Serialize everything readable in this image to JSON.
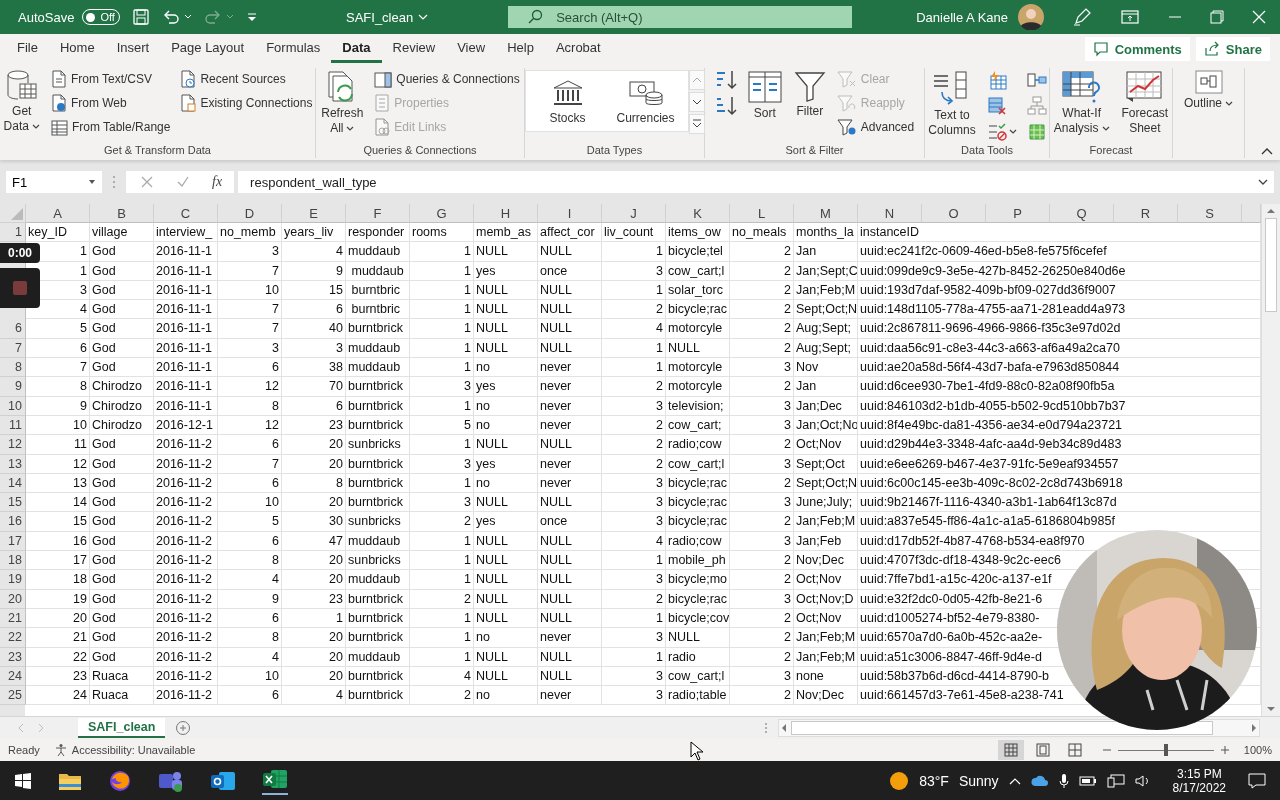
{
  "title_bar": {
    "autosave_label": "AutoSave",
    "autosave_on": false,
    "toggle_text": "Off",
    "file_name": "SAFI_clean",
    "search_placeholder": "Search (Alt+Q)",
    "user_name": "Danielle A Kane"
  },
  "menu_tabs": [
    {
      "label": "File",
      "selected": false
    },
    {
      "label": "Home",
      "selected": false
    },
    {
      "label": "Insert",
      "selected": false
    },
    {
      "label": "Page Layout",
      "selected": false
    },
    {
      "label": "Formulas",
      "selected": false
    },
    {
      "label": "Data",
      "selected": true
    },
    {
      "label": "Review",
      "selected": false
    },
    {
      "label": "View",
      "selected": false
    },
    {
      "label": "Help",
      "selected": false
    },
    {
      "label": "Acrobat",
      "selected": false
    }
  ],
  "comments_button": "Comments",
  "share_button": "Share",
  "ribbon": {
    "groups": [
      {
        "label": "Get & Transform Data",
        "columns": [
          [
            {
              "kind": "large",
              "lines": [
                "Get",
                "Data"
              ],
              "dropdown": true,
              "disabled": false
            }
          ],
          [
            {
              "kind": "small",
              "lines": [
                "From Text/CSV"
              ],
              "dropdown": false,
              "disabled": false
            },
            {
              "kind": "small",
              "lines": [
                "From Web"
              ],
              "dropdown": false,
              "disabled": false
            },
            {
              "kind": "small",
              "lines": [
                "From Table/Range"
              ],
              "dropdown": false,
              "disabled": false
            }
          ],
          [
            {
              "kind": "small",
              "lines": [
                "Recent Sources"
              ],
              "dropdown": false,
              "disabled": false
            },
            {
              "kind": "small",
              "lines": [
                "Existing Connections"
              ],
              "dropdown": false,
              "disabled": false
            }
          ]
        ]
      },
      {
        "label": "Queries & Connections",
        "columns": [
          [
            {
              "kind": "large",
              "lines": [
                "Refresh",
                "All"
              ],
              "dropdown": true,
              "disabled": false
            }
          ],
          [
            {
              "kind": "small",
              "lines": [
                "Queries & Connections"
              ],
              "dropdown": false,
              "disabled": false
            },
            {
              "kind": "small",
              "lines": [
                "Properties"
              ],
              "dropdown": false,
              "disabled": true
            },
            {
              "kind": "small",
              "lines": [
                "Edit Links"
              ],
              "dropdown": false,
              "disabled": true
            }
          ]
        ]
      },
      {
        "label": "Data Types",
        "columns": [
          [
            {
              "kind": "gallery",
              "lines": [
                "Stocks"
              ],
              "dropdown": false,
              "disabled": false
            }
          ],
          [
            {
              "kind": "gallery",
              "lines": [
                "Currencies"
              ],
              "dropdown": false,
              "disabled": false
            }
          ]
        ]
      },
      {
        "label": "Sort & Filter",
        "columns": [
          [
            {
              "kind": "icon",
              "dropdown": false,
              "disabled": false
            },
            {
              "kind": "icon",
              "dropdown": false,
              "disabled": false
            }
          ],
          [
            {
              "kind": "large",
              "lines": [
                "Sort"
              ],
              "dropdown": false,
              "disabled": false
            }
          ],
          [
            {
              "kind": "large",
              "lines": [
                "Filter"
              ],
              "dropdown": false,
              "disabled": false
            }
          ],
          [
            {
              "kind": "small",
              "lines": [
                "Clear"
              ],
              "dropdown": false,
              "disabled": true
            },
            {
              "kind": "small",
              "lines": [
                "Reapply"
              ],
              "dropdown": false,
              "disabled": true
            },
            {
              "kind": "small",
              "lines": [
                "Advanced"
              ],
              "dropdown": false,
              "disabled": false
            }
          ]
        ]
      },
      {
        "label": "Data Tools",
        "columns": [
          [
            {
              "kind": "large",
              "lines": [
                "Text to",
                "Columns"
              ],
              "dropdown": false,
              "disabled": false
            }
          ],
          [
            {
              "kind": "icon",
              "dropdown": false,
              "disabled": false
            },
            {
              "kind": "icon",
              "dropdown": false,
              "disabled": false
            },
            {
              "kind": "icon",
              "dropdown": true,
              "disabled": false
            }
          ],
          [
            {
              "kind": "icon",
              "dropdown": false,
              "disabled": false
            },
            {
              "kind": "icon",
              "dropdown": false,
              "disabled": false
            },
            {
              "kind": "icon",
              "dropdown": false,
              "disabled": false
            }
          ]
        ]
      },
      {
        "label": "Forecast",
        "columns": [
          [
            {
              "kind": "large",
              "lines": [
                "What-If",
                "Analysis"
              ],
              "dropdown": true,
              "disabled": false
            }
          ],
          [
            {
              "kind": "large",
              "lines": [
                "Forecast",
                "Sheet"
              ],
              "dropdown": false,
              "disabled": false
            }
          ]
        ]
      },
      {
        "columns": [
          [
            {
              "kind": "large",
              "lines": [
                "Outline"
              ],
              "dropdown": true,
              "disabled": false
            }
          ]
        ]
      }
    ]
  },
  "formula_bar": {
    "name_box": "F1",
    "fx": "fx",
    "value": "respondent_wall_type"
  },
  "columns": [
    "A",
    "B",
    "C",
    "D",
    "E",
    "F",
    "G",
    "H",
    "I",
    "J",
    "K",
    "L",
    "M",
    "N",
    "O",
    "P",
    "Q",
    "R",
    "S"
  ],
  "rows": [
    {
      "number": "1",
      "cells": [
        "key_ID",
        "village",
        "interview_",
        "no_memb",
        "years_liv",
        "responder",
        "rooms",
        "memb_as",
        "affect_cor",
        "liv_count",
        "items_ow",
        "no_meals",
        "months_la",
        "instanceID"
      ]
    },
    {
      "cells": [
        "1",
        "God",
        "2016-11-1",
        "3",
        "4",
        "muddaub",
        "1",
        "NULL",
        "NULL",
        "1",
        "bicycle;tel",
        "2",
        "Jan",
        "uuid:ec241f2c-0609-46ed-b5e8-fe575f6cefef"
      ]
    },
    {
      "cells": [
        "1",
        "God",
        "2016-11-1",
        "7",
        "9",
        " muddaub",
        "1",
        "yes",
        "once",
        "3",
        "cow_cart;l",
        "2",
        "Jan;Sept;C",
        "uuid:099de9c9-3e5e-427b-8452-26250e840d6e"
      ]
    },
    {
      "cells": [
        "3",
        "God",
        "2016-11-1",
        "10",
        "15",
        " burntbric",
        "1",
        "NULL",
        "NULL",
        "1",
        "solar_torc",
        "2",
        "Jan;Feb;M",
        "uuid:193d7daf-9582-409b-bf09-027dd36f9007"
      ]
    },
    {
      "cells": [
        "4",
        "God",
        "2016-11-1",
        "7",
        "6",
        " burntbric",
        "1",
        "NULL",
        "NULL",
        "2",
        "bicycle;rac",
        "2",
        "Sept;Oct;N",
        "uuid:148d1105-778a-4755-aa71-281eadd4a973"
      ]
    },
    {
      "number": "6",
      "cells": [
        "5",
        "God",
        "2016-11-1",
        "7",
        "40",
        "burntbrick",
        "1",
        "NULL",
        "NULL",
        "4",
        "motorcyle",
        "2",
        "Aug;Sept;",
        "uuid:2c867811-9696-4966-9866-f35c3e97d02d"
      ]
    },
    {
      "number": "7",
      "cells": [
        "6",
        "God",
        "2016-11-1",
        "3",
        "3",
        "muddaub",
        "1",
        "NULL",
        "NULL",
        "1",
        "NULL",
        "2",
        "Aug;Sept;",
        "uuid:daa56c91-c8e3-44c3-a663-af6a49a2ca70"
      ]
    },
    {
      "number": "8",
      "cells": [
        "7",
        "God",
        "2016-11-1",
        "6",
        "38",
        "muddaub",
        "1",
        "no",
        "never",
        "1",
        "motorcyle",
        "3",
        "Nov",
        "uuid:ae20a58d-56f4-43d7-bafa-e7963d850844"
      ]
    },
    {
      "number": "9",
      "cells": [
        "8",
        "Chirodzo",
        "2016-11-1",
        "12",
        "70",
        "burntbrick",
        "3",
        "yes",
        "never",
        "2",
        "motorcyle",
        "2",
        "Jan",
        "uuid:d6cee930-7be1-4fd9-88c0-82a08f90fb5a"
      ]
    },
    {
      "number": "10",
      "cells": [
        "9",
        "Chirodzo",
        "2016-11-1",
        "8",
        "6",
        "burntbrick",
        "1",
        "no",
        "never",
        "3",
        "television;",
        "3",
        "Jan;Dec",
        "uuid:846103d2-b1db-4055-b502-9cd510bb7b37"
      ]
    },
    {
      "number": "11",
      "cells": [
        "10",
        "Chirodzo",
        "2016-12-1",
        "12",
        "23",
        "burntbrick",
        "5",
        "no",
        "never",
        "2",
        "cow_cart;",
        "3",
        "Jan;Oct;No",
        "uuid:8f4e49bc-da81-4356-ae34-e0d794a23721"
      ]
    },
    {
      "number": "12",
      "cells": [
        "11",
        "God",
        "2016-11-2",
        "6",
        "20",
        "sunbricks",
        "1",
        "NULL",
        "NULL",
        "2",
        "radio;cow",
        "2",
        "Oct;Nov",
        "uuid:d29b44e3-3348-4afc-aa4d-9eb34c89d483"
      ]
    },
    {
      "number": "13",
      "cells": [
        "12",
        "God",
        "2016-11-2",
        "7",
        "20",
        "burntbrick",
        "3",
        "yes",
        "never",
        "2",
        "cow_cart;l",
        "3",
        "Sept;Oct",
        "uuid:e6ee6269-b467-4e37-91fc-5e9eaf934557"
      ]
    },
    {
      "number": "14",
      "cells": [
        "13",
        "God",
        "2016-11-2",
        "6",
        "8",
        "burntbrick",
        "1",
        "no",
        "never",
        "3",
        "bicycle;rac",
        "2",
        "Sept;Oct;N",
        "uuid:6c00c145-ee3b-409c-8c02-2c8d743b6918"
      ]
    },
    {
      "number": "15",
      "cells": [
        "14",
        "God",
        "2016-11-2",
        "10",
        "20",
        "burntbrick",
        "3",
        "NULL",
        "NULL",
        "3",
        "bicycle;rac",
        "3",
        "June;July;",
        "uuid:9b21467f-1116-4340-a3b1-1ab64f13c87d"
      ]
    },
    {
      "number": "16",
      "cells": [
        "15",
        "God",
        "2016-11-2",
        "5",
        "30",
        "sunbricks",
        "2",
        "yes",
        "once",
        "3",
        "bicycle;rac",
        "2",
        "Jan;Feb;M",
        "uuid:a837e545-ff86-4a1c-a1a5-6186804b985f"
      ]
    },
    {
      "number": "17",
      "cells": [
        "16",
        "God",
        "2016-11-2",
        "6",
        "47",
        "muddaub",
        "1",
        "NULL",
        "NULL",
        "4",
        "radio;cow",
        "3",
        "Jan;Feb",
        "uuid:d17db52f-4b87-4768-b534-ea8f970"
      ]
    },
    {
      "number": "18",
      "cells": [
        "17",
        "God",
        "2016-11-2",
        "8",
        "20",
        "sunbricks",
        "1",
        "NULL",
        "NULL",
        "1",
        "mobile_ph",
        "2",
        "Nov;Dec",
        "uuid:4707f3dc-df18-4348-9c2c-eec6"
      ]
    },
    {
      "number": "19",
      "cells": [
        "18",
        "God",
        "2016-11-2",
        "4",
        "20",
        "muddaub",
        "1",
        "NULL",
        "NULL",
        "3",
        "bicycle;mo",
        "2",
        "Oct;Nov",
        "uuid:7ffe7bd1-a15c-420c-a137-e1f"
      ]
    },
    {
      "number": "20",
      "cells": [
        "19",
        "God",
        "2016-11-2",
        "9",
        "23",
        "burntbrick",
        "2",
        "NULL",
        "NULL",
        "2",
        "bicycle;rac",
        "3",
        "Oct;Nov;D",
        "uuid:e32f2dc0-0d05-42fb-8e21-6"
      ]
    },
    {
      "number": "21",
      "cells": [
        "20",
        "God",
        "2016-11-2",
        "6",
        "1",
        "burntbrick",
        "1",
        "NULL",
        "NULL",
        "1",
        "bicycle;cov",
        "2",
        "Oct;Nov",
        "uuid:d1005274-bf52-4e79-8380-"
      ]
    },
    {
      "number": "22",
      "cells": [
        "21",
        "God",
        "2016-11-2",
        "8",
        "20",
        "burntbrick",
        "1",
        "no",
        "never",
        "3",
        "NULL",
        "2",
        "Jan;Feb;M",
        "uuid:6570a7d0-6a0b-452c-aa2e-"
      ]
    },
    {
      "number": "23",
      "cells": [
        "22",
        "God",
        "2016-11-2",
        "4",
        "20",
        "muddaub",
        "1",
        "NULL",
        "NULL",
        "1",
        "radio",
        "2",
        "Jan;Feb;M",
        "uuid:a51c3006-8847-46ff-9d4e-d"
      ]
    },
    {
      "number": "24",
      "cells": [
        "23",
        "Ruaca",
        "2016-11-2",
        "10",
        "20",
        "burntbrick",
        "4",
        "NULL",
        "NULL",
        "3",
        "cow_cart;l",
        "3",
        "none",
        "uuid:58b37b6d-d6cd-4414-8790-b"
      ]
    },
    {
      "number": "25",
      "cells": [
        "24",
        "Ruaca",
        "2016-11-2",
        "6",
        "4",
        "burntbrick",
        "2",
        "no",
        "never",
        "3",
        "radio;table",
        "2",
        "Nov;Dec",
        "uuid:661457d3-7e61-45e8-a238-741"
      ]
    }
  ],
  "sheet_tabs": [
    {
      "label": "SAFI_clean",
      "selected": true
    }
  ],
  "status_bar": {
    "ready": "Ready",
    "accessibility": "Accessibility: Unavailable",
    "views": [
      {
        "selected": true
      },
      {
        "selected": false
      },
      {
        "selected": false
      }
    ],
    "zoom": {
      "level": 0.5
    },
    "zoom_text": "100%"
  },
  "recorder": {
    "time": "0:00"
  },
  "taskbar": {
    "temperature": "83°F",
    "weather": "Sunny",
    "time": "3:15 PM",
    "date": "8/17/2022"
  }
}
